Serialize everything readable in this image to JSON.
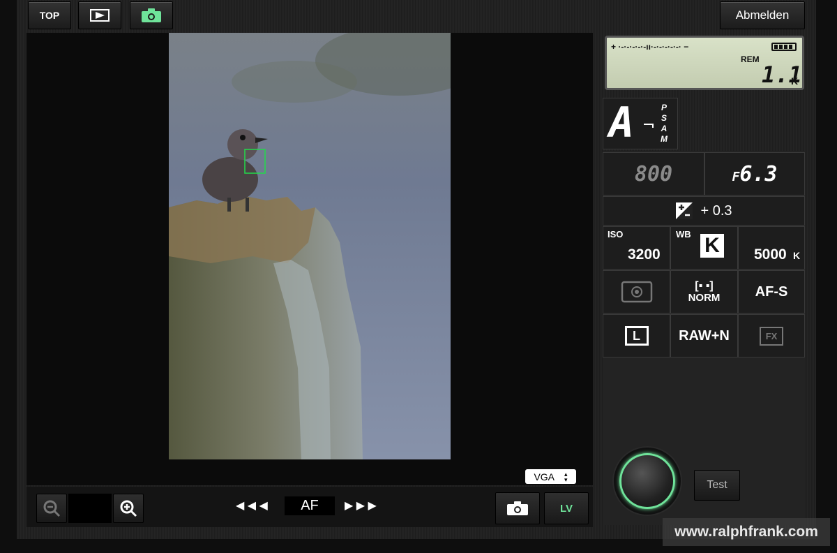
{
  "toolbar": {
    "top_label": "TOP",
    "playback_icon": "playback-icon",
    "camera_icon": "camera-icon",
    "logout_label": "Abmelden"
  },
  "lcd": {
    "exposure_scale": "+ ·-·-·-·-·-ıı·-·-·-·-·-· −",
    "battery_icon": "battery-icon",
    "rem_label": "REM",
    "remaining": "1.1",
    "remaining_unit": "K"
  },
  "mode": {
    "current": "A",
    "modes": [
      "P",
      "S",
      "A",
      "M"
    ]
  },
  "settings": {
    "shutter": "800",
    "aperture_prefix": "F",
    "aperture": "6.3",
    "exposure_comp": "+ 0.3",
    "iso_label": "ISO",
    "iso_value": "3200",
    "wb_label": "WB",
    "wb_mode": "K",
    "wb_kelvin": "5000",
    "wb_unit": "K",
    "metering_icon": "metering-icon",
    "area_label": "NORM",
    "focus_mode": "AF-S",
    "image_size": "L",
    "quality": "RAW+N",
    "format": "FX"
  },
  "bottom": {
    "resolution": "VGA",
    "af_label": "AF",
    "lv_label": "LV",
    "test_label": "Test"
  },
  "watermark": "www.ralphfrank.com",
  "colors": {
    "accent_green": "#6fe39a",
    "af_box": "#22d94a"
  }
}
